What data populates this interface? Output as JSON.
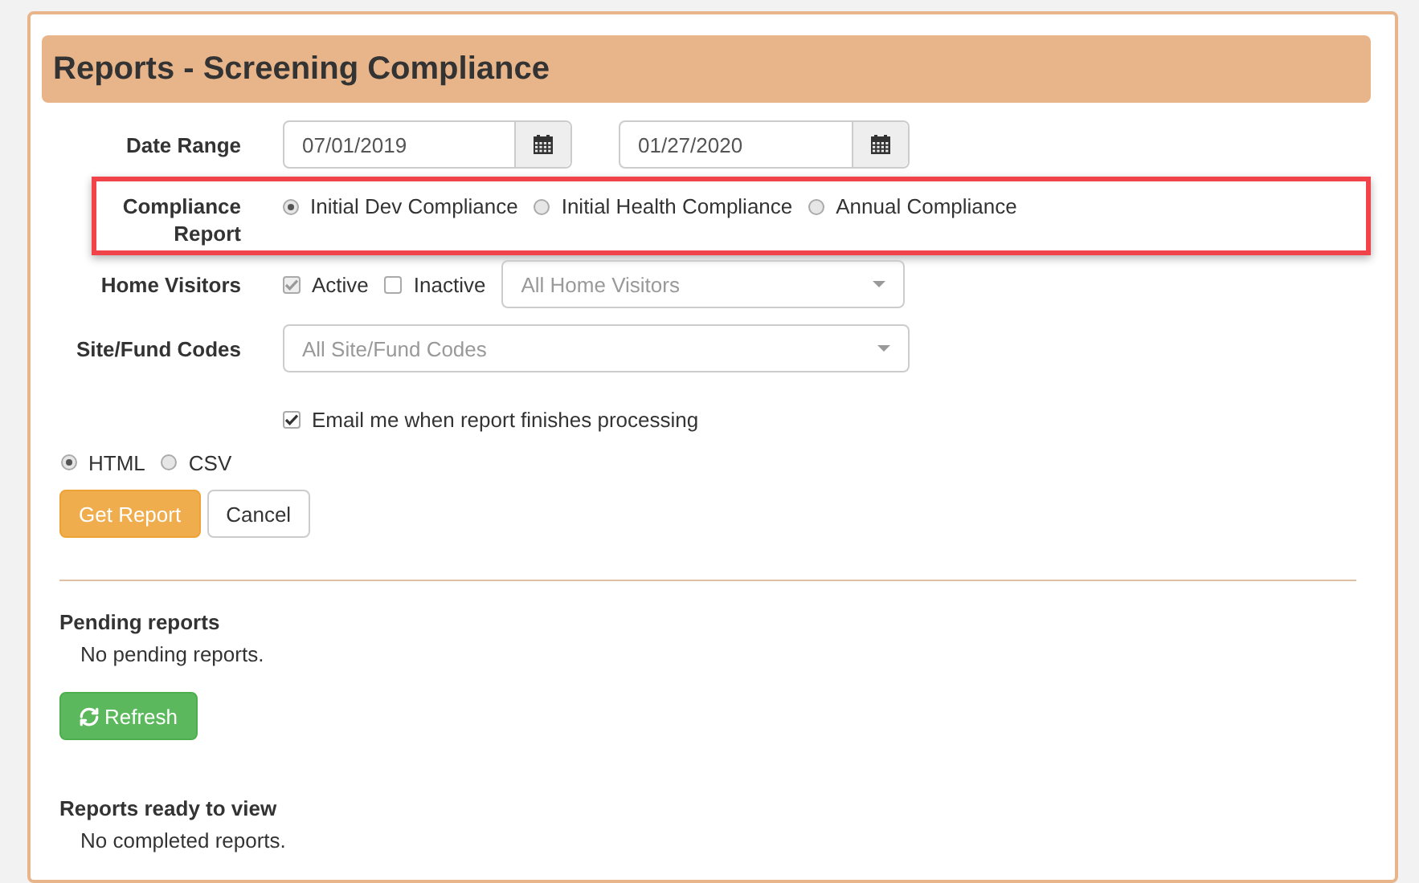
{
  "title": "Reports - Screening Compliance",
  "date_range": {
    "label": "Date Range",
    "start": "07/01/2019",
    "end": "01/27/2020"
  },
  "compliance_report": {
    "label": "Compliance Report",
    "highlighted": true,
    "options": [
      {
        "label": "Initial Dev Compliance",
        "selected": true
      },
      {
        "label": "Initial Health Compliance",
        "selected": false
      },
      {
        "label": "Annual Compliance",
        "selected": false
      }
    ]
  },
  "home_visitors": {
    "label": "Home Visitors",
    "checks": [
      {
        "label": "Active",
        "checked": true,
        "disabled": true
      },
      {
        "label": "Inactive",
        "checked": false,
        "disabled": false
      }
    ],
    "placeholder": "All Home Visitors"
  },
  "site_fund_codes": {
    "label": "Site/Fund Codes",
    "placeholder": "All Site/Fund Codes"
  },
  "email": {
    "label": "Email me when report finishes processing",
    "checked": true
  },
  "formats": [
    {
      "label": "HTML",
      "selected": true
    },
    {
      "label": "CSV",
      "selected": false
    }
  ],
  "buttons": [
    {
      "label": "Get Report",
      "kind": "primary"
    },
    {
      "label": "Cancel",
      "kind": "default"
    }
  ],
  "pending": {
    "heading": "Pending reports",
    "message": "No pending reports.",
    "refresh": "Refresh"
  },
  "ready": {
    "heading": "Reports ready to view",
    "message": "No completed reports."
  }
}
